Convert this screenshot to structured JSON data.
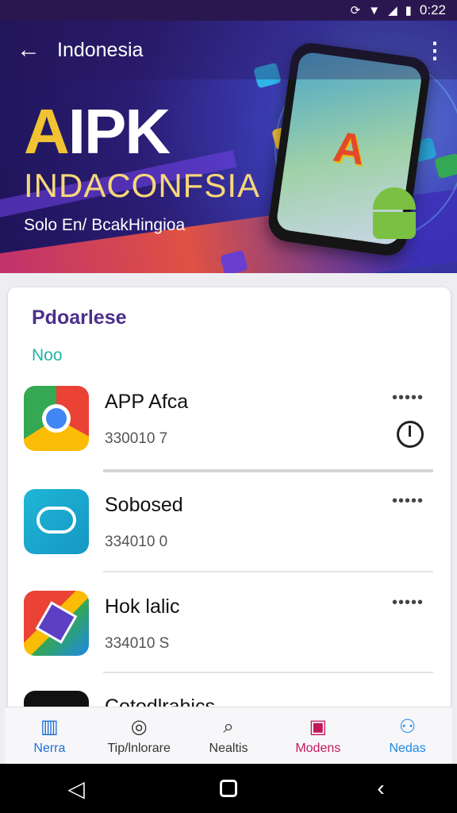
{
  "status_bar": {
    "left_icon": "sync-icon",
    "time": "0:22"
  },
  "app_bar": {
    "title": "Indonesia"
  },
  "hero": {
    "brand_a": "A",
    "brand_rest": "IPK",
    "brand_subtitle": "INDACONFSIA",
    "tagline": "Solo En/ BcakHingioa",
    "phone_logo": "A"
  },
  "section": {
    "title": "Pdoarlese",
    "subtitle": "Noo"
  },
  "apps": [
    {
      "name": "APP Afca",
      "meta": "330010 7",
      "more": "•••••",
      "icon": "chrome-icon"
    },
    {
      "name": "Sobosed",
      "meta": "334010 0",
      "more": "•••••",
      "icon": "cloud-icon"
    },
    {
      "name": "Hok lalic",
      "meta": "334010 S",
      "more": "•••••",
      "icon": "box-icon"
    },
    {
      "name": "Cotodlrahics",
      "meta": "",
      "more": "",
      "icon": "send-icon"
    }
  ],
  "bottom_nav": [
    {
      "label": "Nerra",
      "icon": "home-icon"
    },
    {
      "label": "Tip/lnlorare",
      "icon": "target-icon"
    },
    {
      "label": "Nealtis",
      "icon": "search-icon"
    },
    {
      "label": "Modens",
      "icon": "gift-icon"
    },
    {
      "label": "Nedas",
      "icon": "person-icon"
    }
  ],
  "colors": {
    "accent": "#4a2f8c",
    "teal": "#22b3a6",
    "nav_active": "#1e6fd9"
  }
}
